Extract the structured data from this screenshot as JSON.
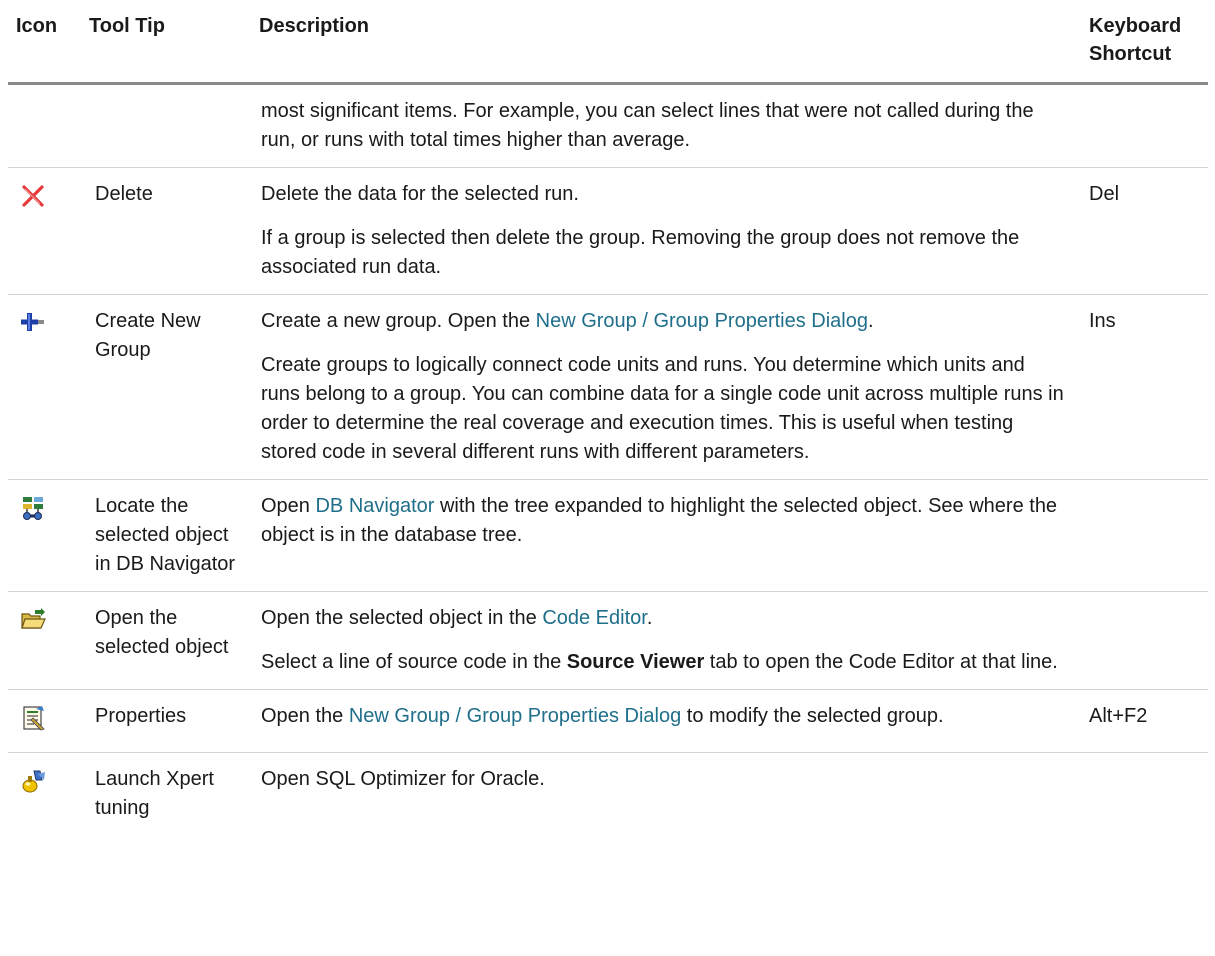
{
  "headers": {
    "icon": "Icon",
    "tooltip": "Tool Tip",
    "description": "Description",
    "shortcut_line1": "Keyboard",
    "shortcut_line2": "Shortcut"
  },
  "rows": [
    {
      "icon": "",
      "tooltip": "",
      "paragraphs": [
        {
          "text": "most significant items. For example, you can select lines that were not called during the run, or runs with total times higher than average."
        }
      ],
      "shortcut": ""
    },
    {
      "icon": "delete-icon",
      "tooltip": "Delete",
      "paragraphs": [
        {
          "text": "Delete the data for the selected run."
        },
        {
          "text": "If a group is selected then delete the group. Removing the group does not remove the associated run data."
        }
      ],
      "shortcut": "Del"
    },
    {
      "icon": "create-group-icon",
      "tooltip": "Create New Group",
      "paragraphs": [
        {
          "before": "Create a new group. Open the ",
          "link": "New Group / Group Properties Dialog",
          "after": "."
        },
        {
          "text": "Create groups to logically connect code units and runs. You determine which units and runs belong to a group. You can combine data for a single code unit across multiple runs in order to determine the real coverage and execution times. This is useful when testing stored code in several different runs with different parameters."
        }
      ],
      "shortcut": "Ins"
    },
    {
      "icon": "db-navigator-icon",
      "tooltip": "Locate the selected object in DB Navigator",
      "paragraphs": [
        {
          "before": "Open ",
          "link": "DB Navigator",
          "after": " with the tree expanded to highlight the selected object. See where the object is in the database tree."
        }
      ],
      "shortcut": ""
    },
    {
      "icon": "open-folder-icon",
      "tooltip": "Open the selected object",
      "paragraphs": [
        {
          "before": "Open the selected object in the ",
          "link": "Code Editor",
          "after": "."
        },
        {
          "before": "Select a line of source code in the ",
          "bold": "Source Viewer",
          "after": " tab to open the Code Editor at that line."
        }
      ],
      "shortcut": ""
    },
    {
      "icon": "properties-icon",
      "tooltip": "Properties",
      "paragraphs": [
        {
          "before": "Open the ",
          "link": "New Group / Group Properties Dialog",
          "after": " to modify the selected group."
        }
      ],
      "shortcut": "Alt+F2"
    },
    {
      "icon": "xpert-tuning-icon",
      "tooltip": "Launch Xpert tuning",
      "paragraphs": [
        {
          "text": "Open SQL Optimizer for Oracle."
        }
      ],
      "shortcut": ""
    }
  ],
  "colors": {
    "link": "#1f6f8b",
    "header_rule": "#8a8a8a",
    "row_rule": "#d4d4d4",
    "delete_icon": "#e5393b"
  }
}
